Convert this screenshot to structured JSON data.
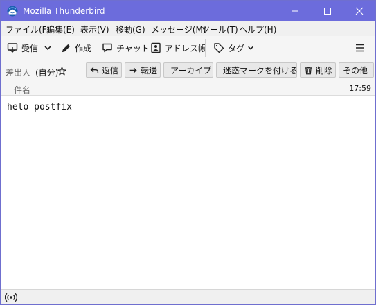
{
  "window": {
    "title": "Mozilla Thunderbird"
  },
  "menu": [
    "ファイル(F)",
    "編集(E)",
    "表示(V)",
    "移動(G)",
    "メッセージ(M)",
    "ツール(T)",
    "ヘルプ(H)"
  ],
  "toolbar": {
    "get_mail": "受信",
    "write": "作成",
    "chat": "チャット",
    "address_book": "アドレス帳",
    "tag": "タグ"
  },
  "header": {
    "from_label": "差出人",
    "from_value": "(自分)",
    "reply": "返信",
    "forward": "転送",
    "archive": "アーカイブ",
    "junk": "迷惑マークを付ける",
    "delete": "削除",
    "more": "その他",
    "subject_label": "件名",
    "time": "17:59"
  },
  "body": {
    "text": "helo postfix"
  },
  "colors": {
    "titlebar": "#6c6cdc",
    "menubar": "#f0f0f0",
    "toolbar": "#f5f5f5"
  },
  "icons": [
    "thunderbird-logo-icon",
    "minimize-icon",
    "maximize-icon",
    "close-icon",
    "get-mail-icon",
    "chevron-down-icon",
    "pencil-icon",
    "chat-bubble-icon",
    "address-book-icon",
    "tag-icon",
    "hamburger-menu-icon",
    "star-icon",
    "reply-icon",
    "forward-icon",
    "archive-icon",
    "junk-icon",
    "trash-icon",
    "online-status-icon"
  ]
}
